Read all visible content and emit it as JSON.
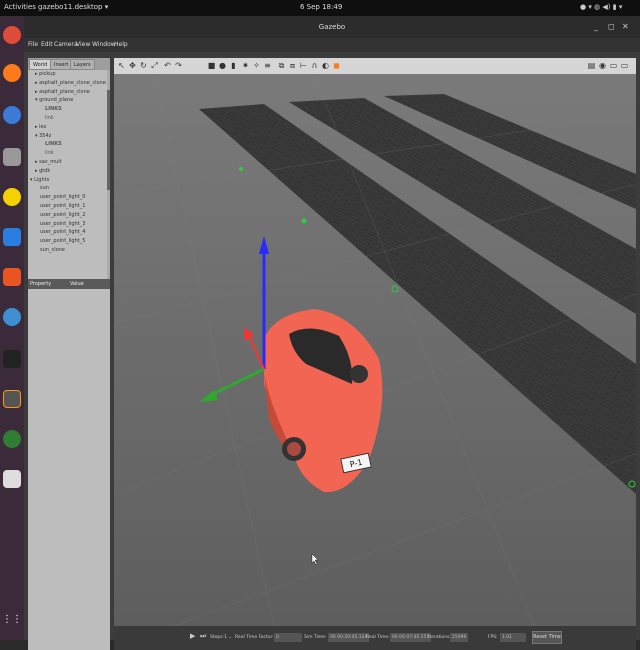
{
  "topbar": {
    "activities": "Activities",
    "app": "gazebo11.desktop ▾",
    "clock": "6 Sep 18:49",
    "tray": "● ▾ ◍ ◀) ▮ ▾"
  },
  "window": {
    "title": "Gazebo",
    "minimize": "_",
    "maximize": "◻",
    "close": "✕"
  },
  "menu": [
    "File",
    "Edit",
    "Camera",
    "View",
    "Window",
    "Help"
  ],
  "left_tabs": [
    "World",
    "Insert",
    "Layers"
  ],
  "tree": [
    {
      "label": "▸ pickup",
      "level": 1
    },
    {
      "label": "▸ asphalt_plane_clone_clone",
      "level": 1
    },
    {
      "label": "▸ asphalt_plane_clone",
      "level": 1
    },
    {
      "label": "▾ ground_plane",
      "level": 1
    },
    {
      "label": "LINKS",
      "level": 3,
      "bold": true
    },
    {
      "label": "link",
      "level": 3
    },
    {
      "label": "▸ lex",
      "level": 1
    },
    {
      "label": "▾ 354z",
      "level": 1
    },
    {
      "label": "LINKS",
      "level": 3,
      "bold": true
    },
    {
      "label": "link",
      "level": 3
    },
    {
      "label": "▸ sav_mult",
      "level": 1
    },
    {
      "label": "▸ gtdk",
      "level": 1
    },
    {
      "label": "▾ Lights",
      "level": 0
    },
    {
      "label": "sun",
      "level": 2
    },
    {
      "label": "user_point_light_0",
      "level": 2
    },
    {
      "label": "user_point_light_1",
      "level": 2
    },
    {
      "label": "user_point_light_2",
      "level": 2
    },
    {
      "label": "user_point_light_3",
      "level": 2
    },
    {
      "label": "user_point_light_4",
      "level": 2
    },
    {
      "label": "user_point_light_5",
      "level": 2
    },
    {
      "label": "sun_clone",
      "level": 2
    }
  ],
  "property_header": {
    "property": "Property",
    "value": "Value"
  },
  "toolbar_icons": [
    "select-icon",
    "translate-icon",
    "rotate-icon",
    "scale-icon",
    "undo-icon",
    "redo-icon",
    "box-icon",
    "sphere-icon",
    "cylinder-icon",
    "pointlight-icon",
    "spotlight-icon",
    "dirlight-icon",
    "copy-icon",
    "paste-icon",
    "align-icon",
    "snap-icon",
    "view-icon",
    "camera-icon"
  ],
  "toolbar_glyphs": [
    "↖",
    "✥",
    "↻",
    "⤢",
    "↶",
    "↷",
    "■",
    "●",
    "▮",
    "✷",
    "✧",
    "≡",
    "⧉",
    "⧈",
    "⊢",
    "∩",
    "◐",
    "◼"
  ],
  "toolbar_right_glyphs": [
    "▤",
    "◉",
    "▭",
    "▭"
  ],
  "scene": {
    "plate": "P-1",
    "car_color": "#f26552",
    "ground": "#6b6b6b"
  },
  "status": {
    "steps_label": "Steps:",
    "steps_value": "1 ⌄",
    "rtf_label": "Real Time Factor:",
    "rtf_value": "0",
    "sim_label": "Sim Time:",
    "sim_value": "00 00:20:45.324",
    "real_label": "Real Time:",
    "real_value": "00 00:07:40.555",
    "iter_label": "Iterations:",
    "iter_value": "25999",
    "fps_label": "FPS:",
    "fps_value": "1.01",
    "reset_label": "Reset Time",
    "play_icon": "▶",
    "step_icon": "⏭"
  }
}
